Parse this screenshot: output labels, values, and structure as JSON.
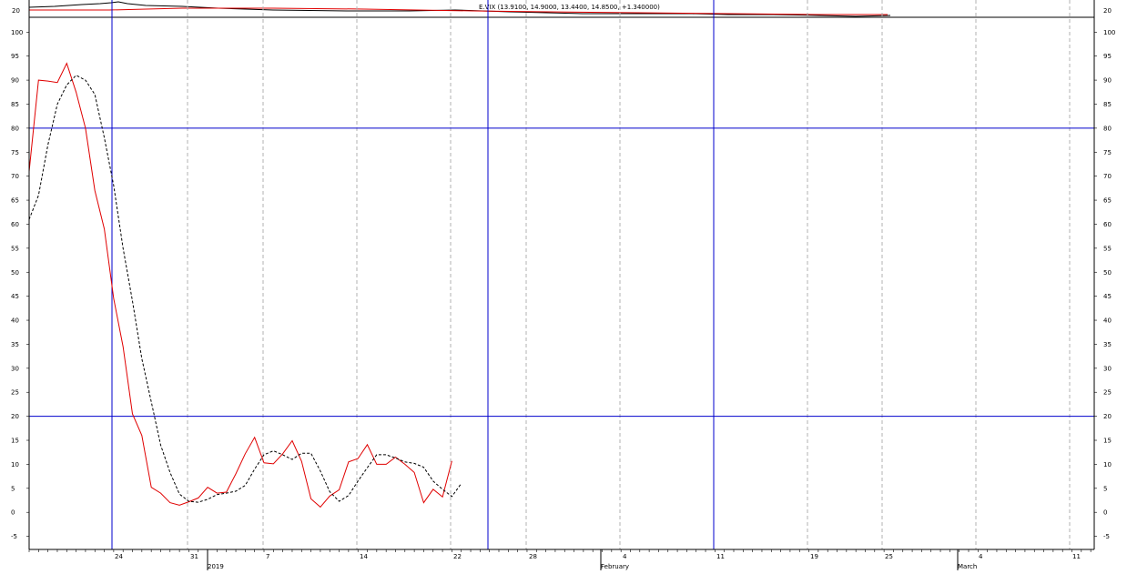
{
  "upper_panel": {
    "label": "E.VIX (13.9100, 14.9000, 13.4400, 14.8500, +1.340000)",
    "y_tick": "20"
  },
  "chart_data": {
    "type": "line",
    "x_labels": [
      "24",
      "31",
      "7",
      "14",
      "22",
      "28",
      "4",
      "11",
      "19",
      "25",
      "4",
      "11"
    ],
    "month_labels": [
      "2019",
      "February",
      "March"
    ],
    "ylim": [
      -7,
      104
    ],
    "yticks": [
      -5,
      0,
      5,
      10,
      15,
      20,
      25,
      30,
      35,
      40,
      45,
      50,
      55,
      60,
      65,
      70,
      75,
      80,
      85,
      90,
      95,
      100
    ],
    "levels": [
      80,
      20
    ],
    "series": [
      {
        "color": "#e00000",
        "style": "solid",
        "values": [
          71,
          90,
          89.8,
          89.5,
          93.5,
          87.5,
          80,
          67,
          59,
          44.5,
          34.5,
          20.5,
          16,
          5.2,
          4,
          2,
          1.5,
          2.2,
          3,
          5.2,
          4,
          4.2,
          8,
          12.2,
          15.6,
          10.3,
          10.1,
          12.2,
          14.9,
          10.6,
          2.8,
          1.1,
          3.4,
          4.7,
          10.5,
          11.2,
          14.1,
          10,
          10,
          11.5,
          10,
          8.3,
          2,
          4.8,
          3.2,
          10.7
        ]
      },
      {
        "color": "#000000",
        "style": "dashed",
        "values": [
          61,
          66,
          76.5,
          85,
          89,
          91,
          90,
          87,
          78,
          68,
          55,
          44,
          32,
          23,
          14,
          8.3,
          3.8,
          2.3,
          2.1,
          2.7,
          3.7,
          4,
          4.4,
          5.6,
          9,
          12,
          12.8,
          12,
          11,
          12.3,
          12.3,
          8.6,
          4.3,
          2.3,
          3.5,
          6.5,
          9.3,
          12,
          12,
          11.3,
          10.5,
          10.2,
          9.4,
          6.5,
          4.8,
          3.3,
          6
        ]
      }
    ]
  }
}
